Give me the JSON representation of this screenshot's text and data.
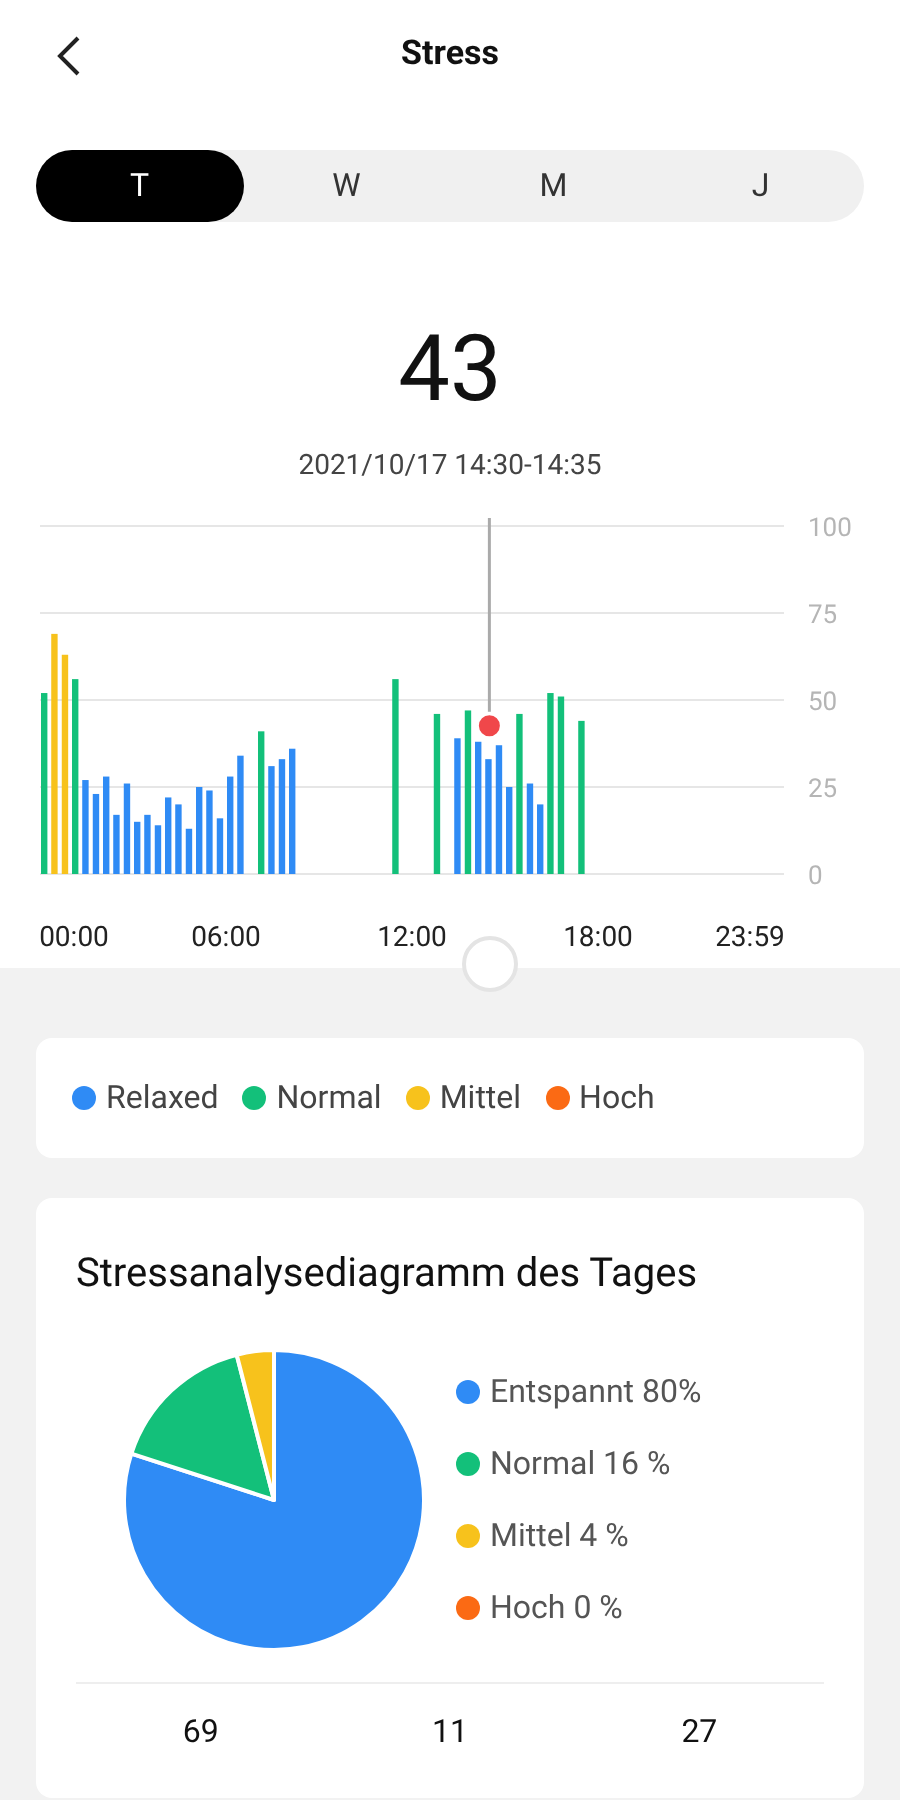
{
  "header": {
    "title": "Stress"
  },
  "tabs": [
    {
      "label": "T",
      "selected": true
    },
    {
      "label": "W",
      "selected": false
    },
    {
      "label": "M",
      "selected": false
    },
    {
      "label": "J",
      "selected": false
    }
  ],
  "score": "43",
  "time_range": "2021/10/17 14:30-14:35",
  "chart_data": {
    "type": "bar",
    "grid": true,
    "xlim": [
      0,
      24
    ],
    "ylim": [
      0,
      100
    ],
    "yticks": [
      0,
      25,
      50,
      75,
      100
    ],
    "xticks": [
      {
        "value": 0,
        "label": "00:00"
      },
      {
        "value": 6,
        "label": "06:00"
      },
      {
        "value": 12,
        "label": "12:00"
      },
      {
        "value": 18,
        "label": "18:00"
      },
      {
        "value": 23.98,
        "label": "23:59"
      }
    ],
    "x": [
      0,
      0.33,
      0.67,
      1,
      1.33,
      1.67,
      2,
      2.33,
      2.67,
      3,
      3.33,
      3.67,
      4,
      4.33,
      4.67,
      5,
      5.33,
      5.67,
      6,
      6.33,
      7,
      7.33,
      7.67,
      8,
      11.33,
      12.67,
      13.33,
      13.67,
      14,
      14.33,
      14.67,
      15,
      15.33,
      15.67,
      16,
      16.33,
      16.67,
      17.33
    ],
    "series": [
      {
        "name": "Relaxed",
        "color": "#2f8bf5",
        "values": [
          null,
          null,
          null,
          null,
          27,
          23,
          28,
          17,
          26,
          15,
          17,
          14,
          22,
          20,
          13,
          25,
          24,
          16,
          28,
          34,
          null,
          31,
          33,
          36,
          null,
          null,
          39,
          null,
          38,
          33,
          37,
          25,
          null,
          26,
          20,
          null,
          null,
          null
        ]
      },
      {
        "name": "Normal",
        "color": "#13c07a",
        "values": [
          52,
          null,
          null,
          56,
          null,
          null,
          null,
          null,
          null,
          null,
          null,
          null,
          null,
          null,
          null,
          null,
          null,
          null,
          null,
          null,
          41,
          null,
          null,
          null,
          56,
          46,
          null,
          47,
          null,
          null,
          null,
          null,
          46,
          null,
          null,
          52,
          51,
          44
        ]
      },
      {
        "name": "Mittel",
        "color": "#f7c21c",
        "values": [
          null,
          69,
          63,
          null,
          null,
          null,
          null,
          null,
          null,
          null,
          null,
          null,
          null,
          null,
          null,
          null,
          null,
          null,
          null,
          null,
          null,
          null,
          null,
          null,
          null,
          null,
          null,
          null,
          null,
          null,
          null,
          null,
          null,
          null,
          null,
          null,
          null,
          null
        ]
      },
      {
        "name": "Hoch",
        "color": "#fb6a14",
        "values": [
          null,
          null,
          null,
          null,
          null,
          null,
          null,
          null,
          null,
          null,
          null,
          null,
          null,
          null,
          null,
          null,
          null,
          null,
          null,
          null,
          null,
          null,
          null,
          null,
          null,
          null,
          null,
          null,
          null,
          null,
          null,
          null,
          null,
          null,
          null,
          null,
          null,
          null
        ]
      }
    ]
  },
  "analysis": {
    "title": "Stressanalysediagramm des Tages",
    "chart_data": {
      "type": "pie",
      "series": [
        {
          "values": [
            80,
            16,
            4,
            0
          ]
        }
      ]
    },
    "legend": [
      {
        "label": "Entspannt 80%",
        "color": "#2f8bf5"
      },
      {
        "label": "Normal 16 %",
        "color": "#13c07a"
      },
      {
        "label": "Mittel 4 %",
        "color": "#f7c21c"
      },
      {
        "label": "Hoch 0 %",
        "color": "#fb6a14"
      }
    ],
    "stats": [
      "69",
      "11",
      "27"
    ]
  }
}
